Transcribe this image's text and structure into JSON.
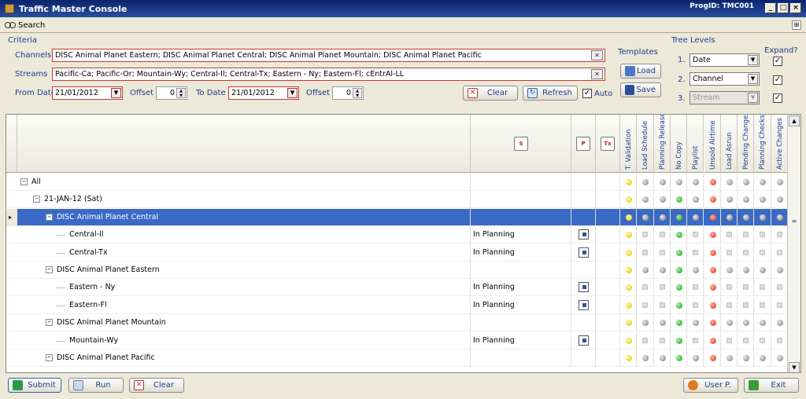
{
  "window": {
    "title": "Traffic Master Console",
    "progid": "ProgID: TMC001"
  },
  "searchbar": {
    "label": "Search"
  },
  "criteria": {
    "group_label": "Criteria",
    "channels_label": "Channels",
    "channels_value": "DISC Animal Planet Eastern; DISC Animal Planet Central; DISC Animal Planet Mountain; DISC Animal Planet Pacific",
    "streams_label": "Streams",
    "streams_value": "Pacific-Ca; Pacific-Or; Mountain-Wy; Central-Il; Central-Tx; Eastern - Ny; Eastern-Fl; cEntrAl-LL",
    "from_date_label": "From Date",
    "from_date": "21/01/2012",
    "offset_label": "Offset",
    "offset_from": "0",
    "to_date_label": "To Date",
    "to_date": "21/01/2012",
    "offset_to": "0",
    "clear_label": "Clear",
    "refresh_label": "Refresh",
    "auto_label": "Auto"
  },
  "templates": {
    "label": "Templates",
    "load_label": "Load",
    "save_label": "Save"
  },
  "tree_levels": {
    "label": "Tree Levels",
    "expand_label": "Expand?",
    "levels": [
      {
        "num": "1.",
        "value": "Date",
        "expand": true
      },
      {
        "num": "2.",
        "value": "Channel",
        "expand": true
      },
      {
        "num": "3.",
        "value": "Stream",
        "expand": true
      }
    ]
  },
  "grid": {
    "header_icons": {
      "s": "S",
      "p": "P",
      "tx": "Tx"
    },
    "status_columns": [
      "T. Validation",
      "Load Schedule",
      "Planning Release",
      "No Copy",
      "Playlist",
      "Unsold Airtime",
      "Load Asrun",
      "Pending Changes",
      "Planning Checks",
      "Active Changes"
    ],
    "rows": [
      {
        "label": "All",
        "level": 0,
        "status": "",
        "p": false,
        "dots": [
          "y",
          "s",
          "s",
          "s",
          "s",
          "r",
          "s",
          "s",
          "s",
          "s"
        ],
        "selected": false
      },
      {
        "label": "21-JAN-12 (Sat)",
        "level": 1,
        "status": "",
        "p": false,
        "dots": [
          "y",
          "s",
          "s",
          "g",
          "s",
          "r",
          "s",
          "s",
          "s",
          "s"
        ],
        "selected": false
      },
      {
        "label": "DISC Animal Planet Central",
        "level": 2,
        "status": "",
        "p": false,
        "dots": [
          "y",
          "s",
          "s",
          "g",
          "s",
          "r",
          "s",
          "s",
          "s",
          "s"
        ],
        "selected": true
      },
      {
        "label": "Central-Il",
        "level": 3,
        "status": "In Planning",
        "p": true,
        "dots": [
          "y",
          "l",
          "l",
          "g",
          "l",
          "r",
          "l",
          "l",
          "l",
          "l"
        ],
        "selected": false
      },
      {
        "label": "Central-Tx",
        "level": 3,
        "status": "In Planning",
        "p": true,
        "dots": [
          "y",
          "l",
          "l",
          "g",
          "l",
          "r",
          "l",
          "l",
          "l",
          "l"
        ],
        "selected": false
      },
      {
        "label": "DISC Animal Planet Eastern",
        "level": 2,
        "status": "",
        "p": false,
        "dots": [
          "y",
          "s",
          "s",
          "g",
          "s",
          "r",
          "s",
          "s",
          "s",
          "s"
        ],
        "selected": false
      },
      {
        "label": "Eastern - Ny",
        "level": 3,
        "status": "In Planning",
        "p": true,
        "dots": [
          "y",
          "l",
          "l",
          "g",
          "l",
          "r",
          "l",
          "l",
          "l",
          "l"
        ],
        "selected": false
      },
      {
        "label": "Eastern-Fl",
        "level": 3,
        "status": "In Planning",
        "p": true,
        "dots": [
          "y",
          "l",
          "l",
          "g",
          "l",
          "r",
          "l",
          "l",
          "l",
          "l"
        ],
        "selected": false
      },
      {
        "label": "DISC Animal Planet Mountain",
        "level": 2,
        "status": "",
        "p": false,
        "dots": [
          "y",
          "s",
          "s",
          "g",
          "s",
          "r",
          "s",
          "s",
          "s",
          "s"
        ],
        "selected": false
      },
      {
        "label": "Mountain-Wy",
        "level": 3,
        "status": "In Planning",
        "p": true,
        "dots": [
          "y",
          "l",
          "l",
          "g",
          "l",
          "r",
          "l",
          "l",
          "l",
          "l"
        ],
        "selected": false
      },
      {
        "label": "DISC Animal Planet Pacific",
        "level": 2,
        "status": "",
        "p": false,
        "dots": [
          "y",
          "s",
          "s",
          "g",
          "s",
          "r",
          "s",
          "s",
          "s",
          "s"
        ],
        "selected": false
      }
    ]
  },
  "footer": {
    "submit_label": "Submit",
    "run_label": "Run",
    "clear_label": "Clear",
    "user_label": "User P.",
    "exit_label": "Exit"
  }
}
